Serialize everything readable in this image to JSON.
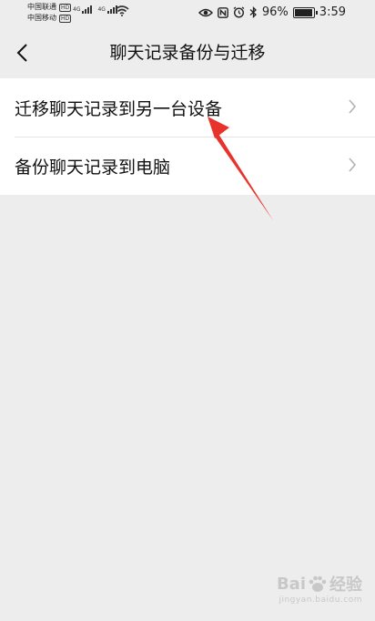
{
  "status_bar": {
    "carrier_1": "中国联通",
    "carrier_2": "中国移动",
    "hd_badge": "HD",
    "network_1": "4G",
    "network_2": "4G",
    "battery_percent": "96%",
    "time": "3:59",
    "icons": [
      "eye-icon",
      "nfc-icon",
      "alarm-icon",
      "bluetooth-icon",
      "wifi-icon",
      "battery-icon"
    ]
  },
  "nav": {
    "title": "聊天记录备份与迁移",
    "back_icon": "chevron-left-icon"
  },
  "menu": {
    "items": [
      {
        "label": "迁移聊天记录到另一台设备",
        "icon": "chevron-right-icon"
      },
      {
        "label": "备份聊天记录到电脑",
        "icon": "chevron-right-icon"
      }
    ]
  },
  "annotation": {
    "arrow_color": "#e8332c"
  },
  "watermark": {
    "brand_left": "Bai",
    "brand_right": "经验",
    "url": "jingyan.baidu.com"
  }
}
